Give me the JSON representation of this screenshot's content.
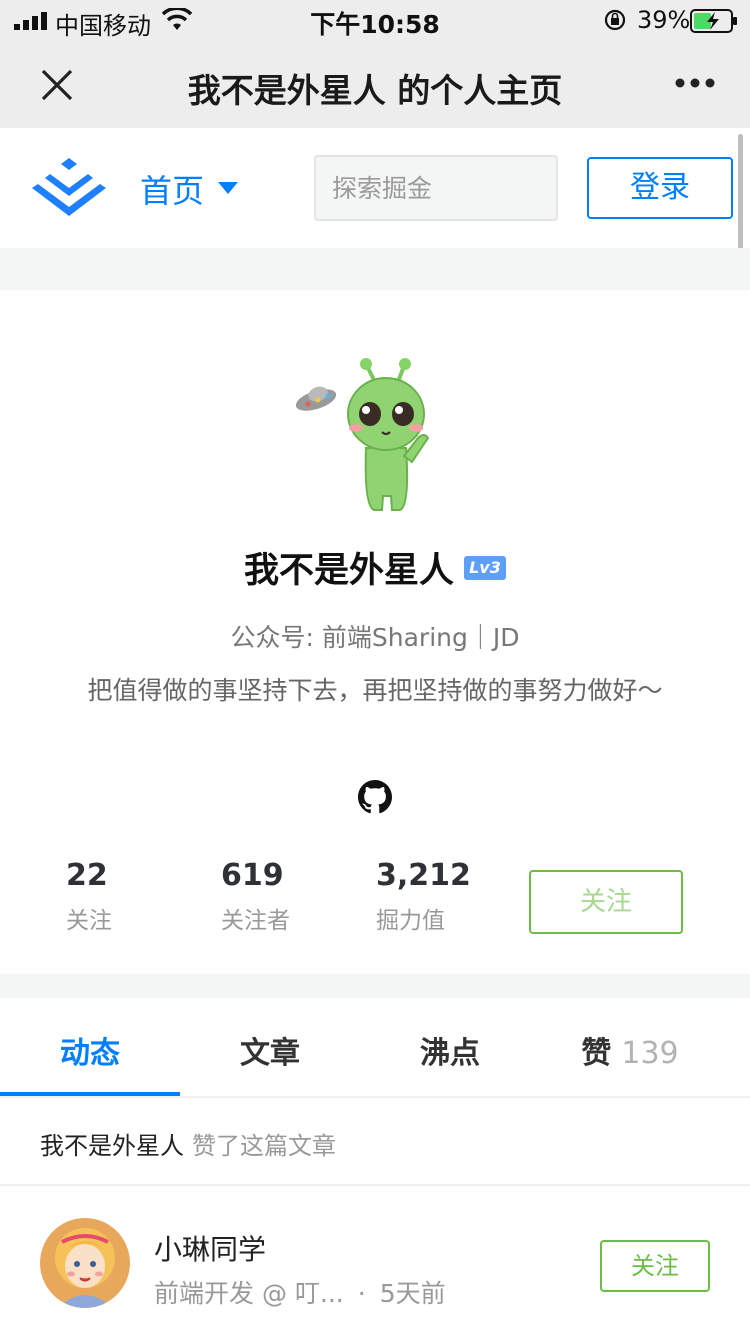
{
  "status_bar": {
    "carrier": "中国移动",
    "time": "下午10:58",
    "battery": "39%"
  },
  "nav": {
    "title": "我不是外星人 的个人主页"
  },
  "site_header": {
    "home_label": "首页",
    "search_placeholder": "探索掘金",
    "login_label": "登录",
    "accent_color": "#007fff"
  },
  "profile": {
    "name": "我不是外星人",
    "level": "Lv3",
    "subtitle": "公众号: 前端Sharing｜JD",
    "bio": "把值得做的事坚持下去，再把坚持做的事努力做好～",
    "stats": [
      {
        "value": "22",
        "label": "关注"
      },
      {
        "value": "619",
        "label": "关注者"
      },
      {
        "value": "3,212",
        "label": "掘力值"
      }
    ],
    "follow_label": "关注"
  },
  "tabs": [
    {
      "label": "动态",
      "active": true
    },
    {
      "label": "文章"
    },
    {
      "label": "沸点"
    },
    {
      "label": "赞",
      "count": "139"
    }
  ],
  "feed": {
    "actor": "我不是外星人",
    "action": "赞了这篇文章",
    "author": {
      "name": "小琳同学",
      "role": "前端开发 @ 叮...",
      "time": "5天前",
      "follow_label": "关注"
    }
  }
}
